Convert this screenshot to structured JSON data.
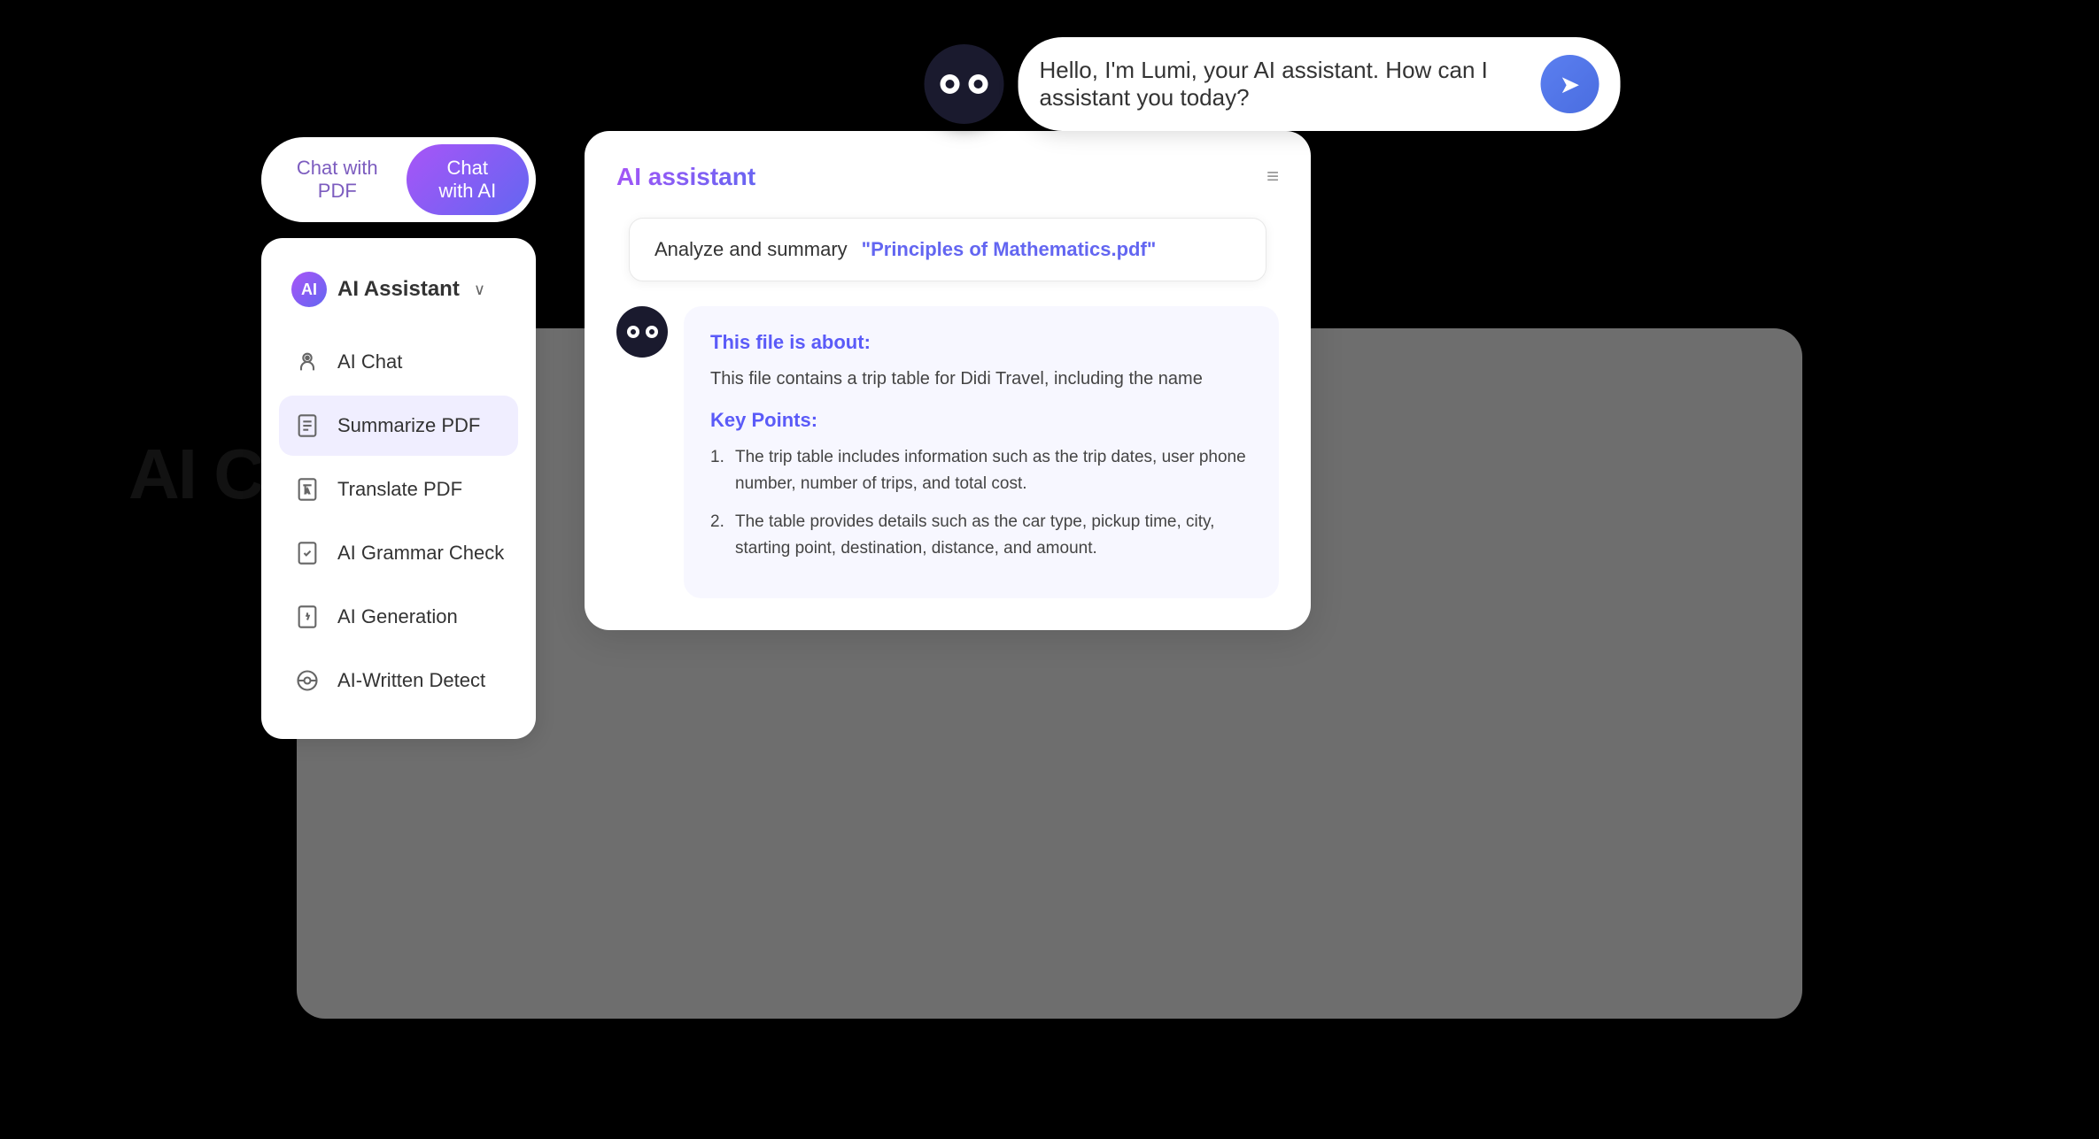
{
  "topBar": {
    "greeting": "Hello, I'm Lumi, your AI assistant. How can I assistant you today?"
  },
  "tabs": {
    "chatPdfLabel": "Chat with PDF",
    "chatAiLabel": "Chat with AI"
  },
  "sidebar": {
    "title": "AI Assistant",
    "items": [
      {
        "id": "ai-chat",
        "label": "AI Chat",
        "icon": "🤖"
      },
      {
        "id": "summarize-pdf",
        "label": "Summarize PDF",
        "icon": "📄",
        "active": true
      },
      {
        "id": "translate-pdf",
        "label": "Translate PDF",
        "icon": "🔤"
      },
      {
        "id": "ai-grammar-check",
        "label": "AI Grammar Check",
        "icon": "✅"
      },
      {
        "id": "ai-generation",
        "label": "AI Generation",
        "icon": "⚡"
      },
      {
        "id": "ai-written-detect",
        "label": "AI-Written Detect",
        "icon": "🔍"
      }
    ]
  },
  "mainPanel": {
    "title": "AI assistant",
    "analyzeLabel": "Analyze and summary",
    "pdfLink": "\"Principles of Mathematics.pdf\"",
    "response": {
      "fileAboutTitle": "This file is about:",
      "fileAboutText": "This file contains a trip table for Didi Travel, including the name",
      "keyPointsTitle": "Key Points:",
      "points": [
        {
          "num": "1",
          "text": "The trip table includes information such as the trip dates, user phone number, number of trips, and total cost."
        },
        {
          "num": "2",
          "text": "The table provides details such as the car type, pickup time, city, starting point, destination, distance, and amount."
        }
      ]
    }
  },
  "overlay": {
    "aiChatText": "AI Chat"
  },
  "colors": {
    "accent": "#6366f1",
    "accentPurple": "#a855f7",
    "aiBlue": "#5b5bf8",
    "dark": "#1a1a2e"
  }
}
